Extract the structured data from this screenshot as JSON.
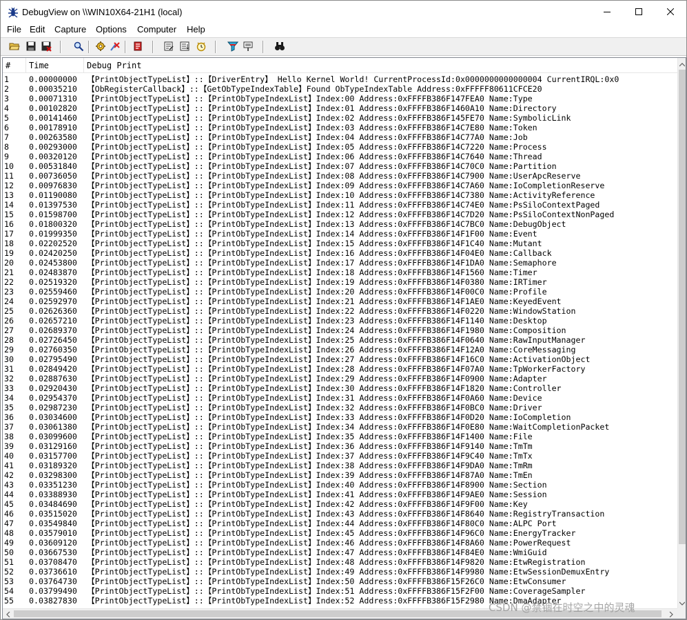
{
  "window": {
    "title": "DebugView on \\\\WIN10X64-21H1 (local)",
    "icons": {
      "app": "debugview-bug-icon",
      "minimize": "minimize-icon",
      "maximize": "maximize-icon",
      "close": "close-icon"
    }
  },
  "menu": [
    "File",
    "Edit",
    "Capture",
    "Options",
    "Computer",
    "Help"
  ],
  "toolbar": {
    "buttons": [
      "open-icon",
      "save-icon",
      "save-as-icon",
      "find-icon",
      "capture-gear-icon",
      "capture-kernel-icon",
      "clear-display-icon",
      "history-icon",
      "autoscroll-icon",
      "clock-icon",
      "filter-icon",
      "highlight-icon",
      "binoculars-icon"
    ]
  },
  "list": {
    "columns": [
      "#",
      "Time",
      "Debug Print"
    ],
    "rows": [
      {
        "n": "1",
        "t": "0.00000000",
        "p": "【PrintObjectTypeList】::【DriverEntry】 Hello Kernel World! CurrentProcessId:0x0000000000000004 CurrentIRQL:0x0"
      },
      {
        "n": "2",
        "t": "0.00035210",
        "p": "【ObRegisterCallback】::【GetObTypeIndexTable】Found ObTypeIndexTable Address:0xFFFFF80611CFCE20"
      },
      {
        "n": "3",
        "t": "0.00071310",
        "p": "【PrintObjectTypeList】::【PrintObTypeIndexList】Index:00  Address:0xFFFFB386F147FEA0 Name:Type"
      },
      {
        "n": "4",
        "t": "0.00102820",
        "p": "【PrintObjectTypeList】::【PrintObTypeIndexList】Index:01  Address:0xFFFFB386F1460A10 Name:Directory"
      },
      {
        "n": "5",
        "t": "0.00141460",
        "p": "【PrintObjectTypeList】::【PrintObTypeIndexList】Index:02  Address:0xFFFFB386F145FE70 Name:SymbolicLink"
      },
      {
        "n": "6",
        "t": "0.00178910",
        "p": "【PrintObjectTypeList】::【PrintObTypeIndexList】Index:03  Address:0xFFFFB386F14C7E80 Name:Token"
      },
      {
        "n": "7",
        "t": "0.00263580",
        "p": "【PrintObjectTypeList】::【PrintObTypeIndexList】Index:04  Address:0xFFFFB386F14C77A0 Name:Job"
      },
      {
        "n": "8",
        "t": "0.00293000",
        "p": "【PrintObjectTypeList】::【PrintObTypeIndexList】Index:05  Address:0xFFFFB386F14C7220 Name:Process"
      },
      {
        "n": "9",
        "t": "0.00320120",
        "p": "【PrintObjectTypeList】::【PrintObTypeIndexList】Index:06  Address:0xFFFFB386F14C7640 Name:Thread"
      },
      {
        "n": "10",
        "t": "0.00531840",
        "p": "【PrintObjectTypeList】::【PrintObTypeIndexList】Index:07  Address:0xFFFFB386F14C70C0 Name:Partition"
      },
      {
        "n": "11",
        "t": "0.00736050",
        "p": "【PrintObjectTypeList】::【PrintObTypeIndexList】Index:08  Address:0xFFFFB386F14C7900 Name:UserApcReserve"
      },
      {
        "n": "12",
        "t": "0.00976830",
        "p": "【PrintObjectTypeList】::【PrintObTypeIndexList】Index:09  Address:0xFFFFB386F14C7A60 Name:IoCompletionReserve"
      },
      {
        "n": "13",
        "t": "0.01190080",
        "p": "【PrintObjectTypeList】::【PrintObTypeIndexList】Index:10  Address:0xFFFFB386F14C7380 Name:ActivityReference"
      },
      {
        "n": "14",
        "t": "0.01397530",
        "p": "【PrintObjectTypeList】::【PrintObTypeIndexList】Index:11  Address:0xFFFFB386F14C74E0 Name:PsSiloContextPaged"
      },
      {
        "n": "15",
        "t": "0.01598700",
        "p": "【PrintObjectTypeList】::【PrintObTypeIndexList】Index:12  Address:0xFFFFB386F14C7D20 Name:PsSiloContextNonPaged"
      },
      {
        "n": "16",
        "t": "0.01800320",
        "p": "【PrintObjectTypeList】::【PrintObTypeIndexList】Index:13  Address:0xFFFFB386F14C7BC0 Name:DebugObject"
      },
      {
        "n": "17",
        "t": "0.01999350",
        "p": "【PrintObjectTypeList】::【PrintObTypeIndexList】Index:14  Address:0xFFFFB386F14F1F00 Name:Event"
      },
      {
        "n": "18",
        "t": "0.02202520",
        "p": "【PrintObjectTypeList】::【PrintObTypeIndexList】Index:15  Address:0xFFFFB386F14F1C40 Name:Mutant"
      },
      {
        "n": "19",
        "t": "0.02420250",
        "p": "【PrintObjectTypeList】::【PrintObTypeIndexList】Index:16  Address:0xFFFFB386F14F04E0 Name:Callback"
      },
      {
        "n": "20",
        "t": "0.02453800",
        "p": "【PrintObjectTypeList】::【PrintObTypeIndexList】Index:17  Address:0xFFFFB386F14F1DA0 Name:Semaphore"
      },
      {
        "n": "21",
        "t": "0.02483870",
        "p": "【PrintObjectTypeList】::【PrintObTypeIndexList】Index:18  Address:0xFFFFB386F14F1560 Name:Timer"
      },
      {
        "n": "22",
        "t": "0.02519320",
        "p": "【PrintObjectTypeList】::【PrintObTypeIndexList】Index:19  Address:0xFFFFB386F14F0380 Name:IRTimer"
      },
      {
        "n": "23",
        "t": "0.02559460",
        "p": "【PrintObjectTypeList】::【PrintObTypeIndexList】Index:20  Address:0xFFFFB386F14F00C0 Name:Profile"
      },
      {
        "n": "24",
        "t": "0.02592970",
        "p": "【PrintObjectTypeList】::【PrintObTypeIndexList】Index:21  Address:0xFFFFB386F14F1AE0 Name:KeyedEvent"
      },
      {
        "n": "25",
        "t": "0.02626360",
        "p": "【PrintObjectTypeList】::【PrintObTypeIndexList】Index:22  Address:0xFFFFB386F14F0220 Name:WindowStation"
      },
      {
        "n": "26",
        "t": "0.02657210",
        "p": "【PrintObjectTypeList】::【PrintObTypeIndexList】Index:23  Address:0xFFFFB386F14F1140 Name:Desktop"
      },
      {
        "n": "27",
        "t": "0.02689370",
        "p": "【PrintObjectTypeList】::【PrintObTypeIndexList】Index:24  Address:0xFFFFB386F14F1980 Name:Composition"
      },
      {
        "n": "28",
        "t": "0.02726450",
        "p": "【PrintObjectTypeList】::【PrintObTypeIndexList】Index:25  Address:0xFFFFB386F14F0640 Name:RawInputManager"
      },
      {
        "n": "29",
        "t": "0.02760350",
        "p": "【PrintObjectTypeList】::【PrintObTypeIndexList】Index:26  Address:0xFFFFB386F14F12A0 Name:CoreMessaging"
      },
      {
        "n": "30",
        "t": "0.02795490",
        "p": "【PrintObjectTypeList】::【PrintObTypeIndexList】Index:27  Address:0xFFFFB386F14F16C0 Name:ActivationObject"
      },
      {
        "n": "31",
        "t": "0.02849420",
        "p": "【PrintObjectTypeList】::【PrintObTypeIndexList】Index:28  Address:0xFFFFB386F14F07A0 Name:TpWorkerFactory"
      },
      {
        "n": "32",
        "t": "0.02887630",
        "p": "【PrintObjectTypeList】::【PrintObTypeIndexList】Index:29  Address:0xFFFFB386F14F0900 Name:Adapter"
      },
      {
        "n": "33",
        "t": "0.02920430",
        "p": "【PrintObjectTypeList】::【PrintObTypeIndexList】Index:30  Address:0xFFFFB386F14F1820 Name:Controller"
      },
      {
        "n": "34",
        "t": "0.02954370",
        "p": "【PrintObjectTypeList】::【PrintObTypeIndexList】Index:31  Address:0xFFFFB386F14F0A60 Name:Device"
      },
      {
        "n": "35",
        "t": "0.02987230",
        "p": "【PrintObjectTypeList】::【PrintObTypeIndexList】Index:32  Address:0xFFFFB386F14F0BC0 Name:Driver"
      },
      {
        "n": "36",
        "t": "0.03034600",
        "p": "【PrintObjectTypeList】::【PrintObTypeIndexList】Index:33  Address:0xFFFFB386F14F0D20 Name:IoCompletion"
      },
      {
        "n": "37",
        "t": "0.03061380",
        "p": "【PrintObjectTypeList】::【PrintObTypeIndexList】Index:34  Address:0xFFFFB386F14F0E80 Name:WaitCompletionPacket"
      },
      {
        "n": "38",
        "t": "0.03099600",
        "p": "【PrintObjectTypeList】::【PrintObTypeIndexList】Index:35  Address:0xFFFFB386F14F1400 Name:File"
      },
      {
        "n": "39",
        "t": "0.03129160",
        "p": "【PrintObjectTypeList】::【PrintObTypeIndexList】Index:36  Address:0xFFFFB386F14F9140 Name:TmTm"
      },
      {
        "n": "40",
        "t": "0.03157700",
        "p": "【PrintObjectTypeList】::【PrintObTypeIndexList】Index:37  Address:0xFFFFB386F14F9C40 Name:TmTx"
      },
      {
        "n": "41",
        "t": "0.03189320",
        "p": "【PrintObjectTypeList】::【PrintObTypeIndexList】Index:38  Address:0xFFFFB386F14F9DA0 Name:TmRm"
      },
      {
        "n": "42",
        "t": "0.03298300",
        "p": "【PrintObjectTypeList】::【PrintObTypeIndexList】Index:39  Address:0xFFFFB386F14F87A0 Name:TmEn"
      },
      {
        "n": "43",
        "t": "0.03351230",
        "p": "【PrintObjectTypeList】::【PrintObTypeIndexList】Index:40  Address:0xFFFFB386F14F8900 Name:Section"
      },
      {
        "n": "44",
        "t": "0.03388930",
        "p": "【PrintObjectTypeList】::【PrintObTypeIndexList】Index:41  Address:0xFFFFB386F14F9AE0 Name:Session"
      },
      {
        "n": "45",
        "t": "0.03484690",
        "p": "【PrintObjectTypeList】::【PrintObTypeIndexList】Index:42  Address:0xFFFFB386F14F9F00 Name:Key"
      },
      {
        "n": "46",
        "t": "0.03515020",
        "p": "【PrintObjectTypeList】::【PrintObTypeIndexList】Index:43  Address:0xFFFFB386F14F8640 Name:RegistryTransaction"
      },
      {
        "n": "47",
        "t": "0.03549840",
        "p": "【PrintObjectTypeList】::【PrintObTypeIndexList】Index:44  Address:0xFFFFB386F14F80C0 Name:ALPC Port"
      },
      {
        "n": "48",
        "t": "0.03579010",
        "p": "【PrintObjectTypeList】::【PrintObTypeIndexList】Index:45  Address:0xFFFFB386F14F96C0 Name:EnergyTracker"
      },
      {
        "n": "49",
        "t": "0.03609120",
        "p": "【PrintObjectTypeList】::【PrintObTypeIndexList】Index:46  Address:0xFFFFB386F14F8A60 Name:PowerRequest"
      },
      {
        "n": "50",
        "t": "0.03667530",
        "p": "【PrintObjectTypeList】::【PrintObTypeIndexList】Index:47  Address:0xFFFFB386F14F84E0 Name:WmiGuid"
      },
      {
        "n": "51",
        "t": "0.03708470",
        "p": "【PrintObjectTypeList】::【PrintObTypeIndexList】Index:48  Address:0xFFFFB386F14F9820 Name:EtwRegistration"
      },
      {
        "n": "52",
        "t": "0.03736610",
        "p": "【PrintObjectTypeList】::【PrintObTypeIndexList】Index:49  Address:0xFFFFB386F14F9980 Name:EtwSessionDemuxEntry"
      },
      {
        "n": "53",
        "t": "0.03764730",
        "p": "【PrintObjectTypeList】::【PrintObTypeIndexList】Index:50  Address:0xFFFFB386F15F26C0 Name:EtwConsumer"
      },
      {
        "n": "54",
        "t": "0.03799490",
        "p": "【PrintObjectTypeList】::【PrintObTypeIndexList】Index:51  Address:0xFFFFB386F15F2F00 Name:CoverageSampler"
      },
      {
        "n": "55",
        "t": "0.03827830",
        "p": "【PrintObjectTypeList】::【PrintObTypeIndexList】Index:52  Address:0xFFFFB386F15F2980 Name:DmaAdapter"
      }
    ]
  },
  "watermark": "CSDN @禁锢在时空之中的灵魂"
}
